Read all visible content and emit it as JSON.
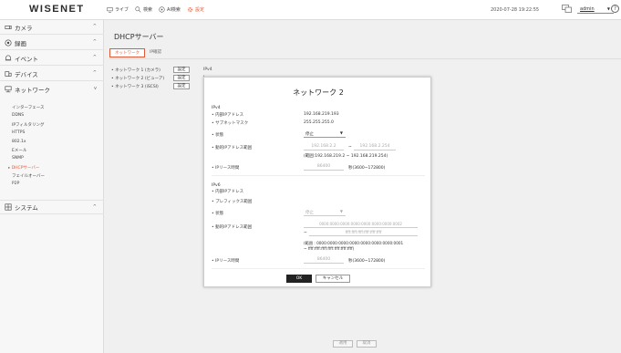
{
  "app": {
    "logo": "WISENET"
  },
  "topmenu": [
    {
      "label": "ライブ",
      "icon": "monitor-icon"
    },
    {
      "label": "検索",
      "icon": "search-icon"
    },
    {
      "label": "AI検索",
      "icon": "ai-search-icon"
    },
    {
      "label": "設定",
      "icon": "gear-icon",
      "active": true
    }
  ],
  "header": {
    "datetime": "2020-07-28 19:22:55",
    "user": "admin",
    "help": "?"
  },
  "sidebar": {
    "items": [
      {
        "label": "カメラ",
        "icon": "camera-icon",
        "chev": "^"
      },
      {
        "label": "録画",
        "icon": "record-icon",
        "chev": "^"
      },
      {
        "label": "イベント",
        "icon": "bell-icon",
        "chev": "^"
      },
      {
        "label": "デバイス",
        "icon": "device-icon",
        "chev": "^"
      },
      {
        "label": "ネットワーク",
        "icon": "network-icon",
        "chev": "v"
      },
      {
        "label": "システム",
        "icon": "system-icon",
        "chev": "^"
      }
    ],
    "network_sub": [
      "インターフェース",
      "DDNS",
      "IPフィルタリング",
      "HTTPS",
      "802.1x",
      "Eメール",
      "SNMP",
      "DHCPサーバー",
      "フェイルオーバー",
      "P2P"
    ]
  },
  "main": {
    "title": "DHCPサーバー",
    "tabs": [
      "ネットワーク",
      "IP確認"
    ],
    "rows": [
      {
        "label": "ネットワーク 1 (カメラ)",
        "button": "設定",
        "ip": "IPv4"
      },
      {
        "label": "ネットワーク 2 (ビューア)",
        "button": "設定",
        "ip": "I"
      },
      {
        "label": "ネットワーク 3 (iSCSI)",
        "button": "設定",
        "ip": "I"
      }
    ],
    "apply": "適用",
    "cancel": "取消"
  },
  "modal": {
    "title": "ネットワーク 2",
    "ipv4": {
      "section": "IPv4",
      "internal_ip_label": "内部IPアドレス",
      "internal_ip": "192.168.219.193",
      "subnet_label": "サブネットマスク",
      "subnet": "255.255.255.0",
      "state_label": "状態",
      "state": "停止",
      "range_label": "動的IPアドレス範囲",
      "range_start": "192.168.2.2",
      "range_sep": "~",
      "range_end": "192.168.2.254",
      "range_hint": "(範囲:192.168.219.2 ~ 192.168.219.254)",
      "lease_label": "IPリース時間",
      "lease": "86400",
      "lease_hint": "秒(3600~172800)"
    },
    "ipv6": {
      "section": "IPv6",
      "internal_ip_label": "内部IPアドレス",
      "prefix_label": "プレフィックス範囲",
      "state_label": "状態",
      "state": "停止",
      "range_label": "動的IPアドレス範囲",
      "range_start": "0000:0000:0000:0000:0000:0000:0000:0002",
      "range_sep": "~",
      "range_end": "ffff:ffff:ffff:ffff:ffff:ffff",
      "range_hint_1": "(範囲 : 0000:0000:0000:0000:0000:0000:0000:0001",
      "range_hint_2": "~ ffff:ffff:ffff:ffff:ffff:ffff:ffff)",
      "lease_label": "IPリース時間",
      "lease": "86400",
      "lease_hint": "秒(3600~172800)"
    },
    "ok": "OK",
    "cancel": "キャンセル"
  }
}
